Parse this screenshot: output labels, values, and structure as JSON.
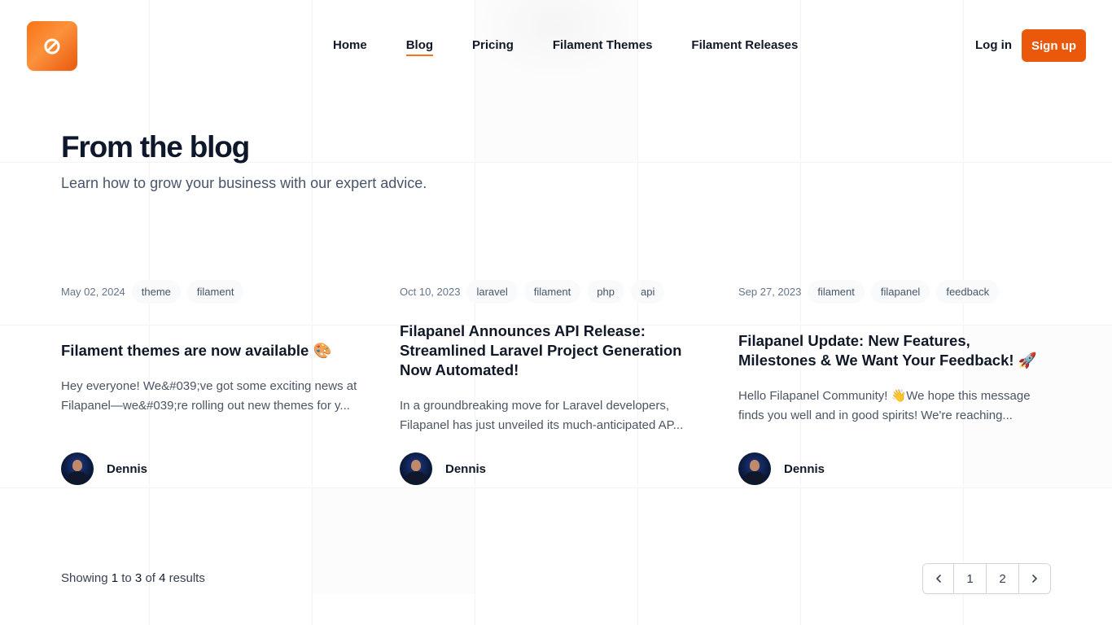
{
  "header": {
    "nav": [
      {
        "label": "Home",
        "active": false
      },
      {
        "label": "Blog",
        "active": true
      },
      {
        "label": "Pricing",
        "active": false
      },
      {
        "label": "Filament Themes",
        "active": false
      },
      {
        "label": "Filament Releases",
        "active": false
      }
    ],
    "login_label": "Log in",
    "signup_label": "Sign up",
    "accent_color": "#ea580c"
  },
  "hero": {
    "title": "From the blog",
    "subtitle": "Learn how to grow your business with our expert advice."
  },
  "posts": [
    {
      "date": "May 02, 2024",
      "tags": [
        "theme",
        "filament"
      ],
      "title": "Filament themes are now available 🎨",
      "excerpt": "Hey everyone! We&#039;ve got some exciting news at Filapanel—we&#039;re rolling out new themes for y...",
      "author": "Dennis"
    },
    {
      "date": "Oct 10, 2023",
      "tags": [
        "laravel",
        "filament",
        "php",
        "api"
      ],
      "title": "Filapanel Announces API Release: Streamlined Laravel Project Generation Now Automated!",
      "excerpt": "In a groundbreaking move for Laravel developers, Filapanel has just unveiled its much-anticipated AP...",
      "author": "Dennis"
    },
    {
      "date": "Sep 27, 2023",
      "tags": [
        "filament",
        "filapanel",
        "feedback"
      ],
      "title": "Filapanel Update: New Features, Milestones & We Want Your Feedback! 🚀",
      "excerpt": "Hello Filapanel Community! 👋We hope this message finds you well and in good spirits! We're reaching...",
      "author": "Dennis"
    }
  ],
  "pagination": {
    "showing_prefix": "Showing",
    "from": "1",
    "to_word": "to",
    "to": "3",
    "of_word": "of",
    "total": "4",
    "results_word": "results",
    "pages": [
      "1",
      "2"
    ],
    "prev_icon": "chevron-left-icon",
    "next_icon": "chevron-right-icon"
  }
}
